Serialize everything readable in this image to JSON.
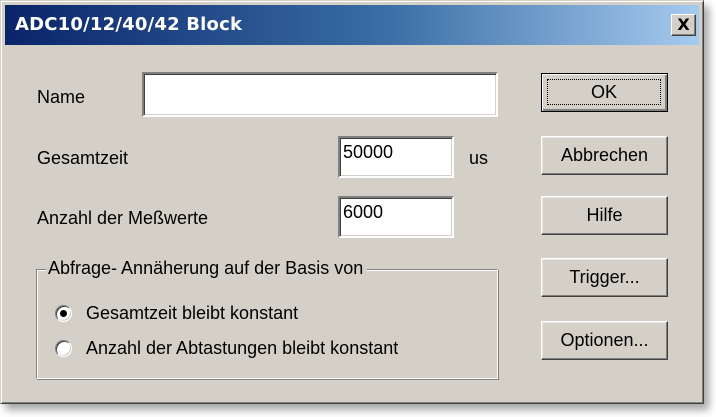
{
  "window": {
    "title": "ADC10/12/40/42 Block",
    "close_glyph": "X"
  },
  "form": {
    "name_label": "Name",
    "name_value": "",
    "gesamtzeit_label": "Gesamtzeit",
    "gesamtzeit_value": "50000",
    "gesamtzeit_unit": "us",
    "messwerte_label": "Anzahl der Meßwerte",
    "messwerte_value": "6000"
  },
  "group": {
    "legend": "Abfrage- Annäherung auf der Basis von",
    "options": [
      {
        "label": "Gesamtzeit bleibt konstant",
        "checked": true
      },
      {
        "label": "Anzahl der Abtastungen bleibt konstant",
        "checked": false
      }
    ]
  },
  "buttons": {
    "ok": "OK",
    "cancel": "Abbrechen",
    "help": "Hilfe",
    "trigger": "Trigger...",
    "options": "Optionen..."
  },
  "colors": {
    "titlebar_start": "#0a246a",
    "titlebar_end": "#a6caf0",
    "dialog_face": "#d4d0c8"
  }
}
